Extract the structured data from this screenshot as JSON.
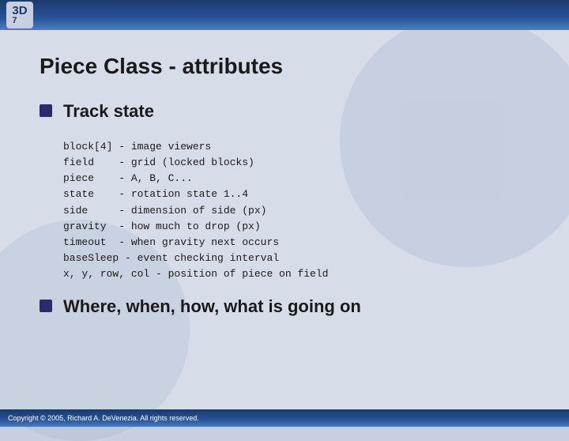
{
  "header": {
    "logo_line1": "3D",
    "logo_line2": "7"
  },
  "footer": {
    "copyright": "Copyright © 2005, Richard A. DeVenezia. All rights reserved."
  },
  "page": {
    "title": "Piece Class - attributes",
    "section1": {
      "bullet": "■",
      "heading": "Track state",
      "code": "block[4] - image viewers\nfield    - grid (locked blocks)\npiece    - A, B, C...\nstate    - rotation state 1..4\nside     - dimension of side (px)\ngravity  - how much to drop (px)\ntimeout  - when gravity next occurs\nbaseSleep - event checking interval\nx, y, row, col - position of piece on field"
    },
    "section2": {
      "bullet": "■",
      "heading": "Where, when, how, what is going on"
    }
  }
}
